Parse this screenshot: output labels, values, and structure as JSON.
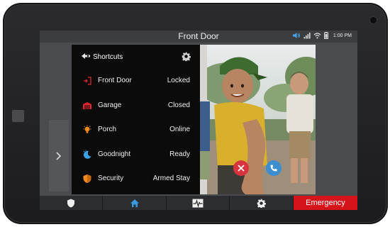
{
  "screen": {
    "title": "Front Door",
    "time": "1:00 PM"
  },
  "shortcuts": {
    "header": "Shortcuts",
    "items": [
      {
        "name": "Front Door",
        "state": "Locked",
        "icon": "door-lock-icon"
      },
      {
        "name": "Garage",
        "state": "Closed",
        "icon": "garage-icon"
      },
      {
        "name": "Porch",
        "state": "Online",
        "icon": "light-bulb-icon"
      },
      {
        "name": "Goodnight",
        "state": "Ready",
        "icon": "moon-icon"
      },
      {
        "name": "Security",
        "state": "Armed Stay",
        "icon": "shield-icon"
      }
    ]
  },
  "navbar": {
    "items": [
      {
        "icon": "shield-icon"
      },
      {
        "icon": "home-icon"
      },
      {
        "icon": "activity-icon"
      },
      {
        "icon": "gear-icon"
      }
    ],
    "emergency_label": "Emergency"
  },
  "colors": {
    "emergency": "#d5131a",
    "reject": "#d8343d",
    "answer": "#3c8fcf",
    "home_active": "#3a97e0",
    "icon_red": "#e0262e",
    "icon_orange": "#ef8a1e",
    "icon_blue": "#3aa0e8"
  }
}
